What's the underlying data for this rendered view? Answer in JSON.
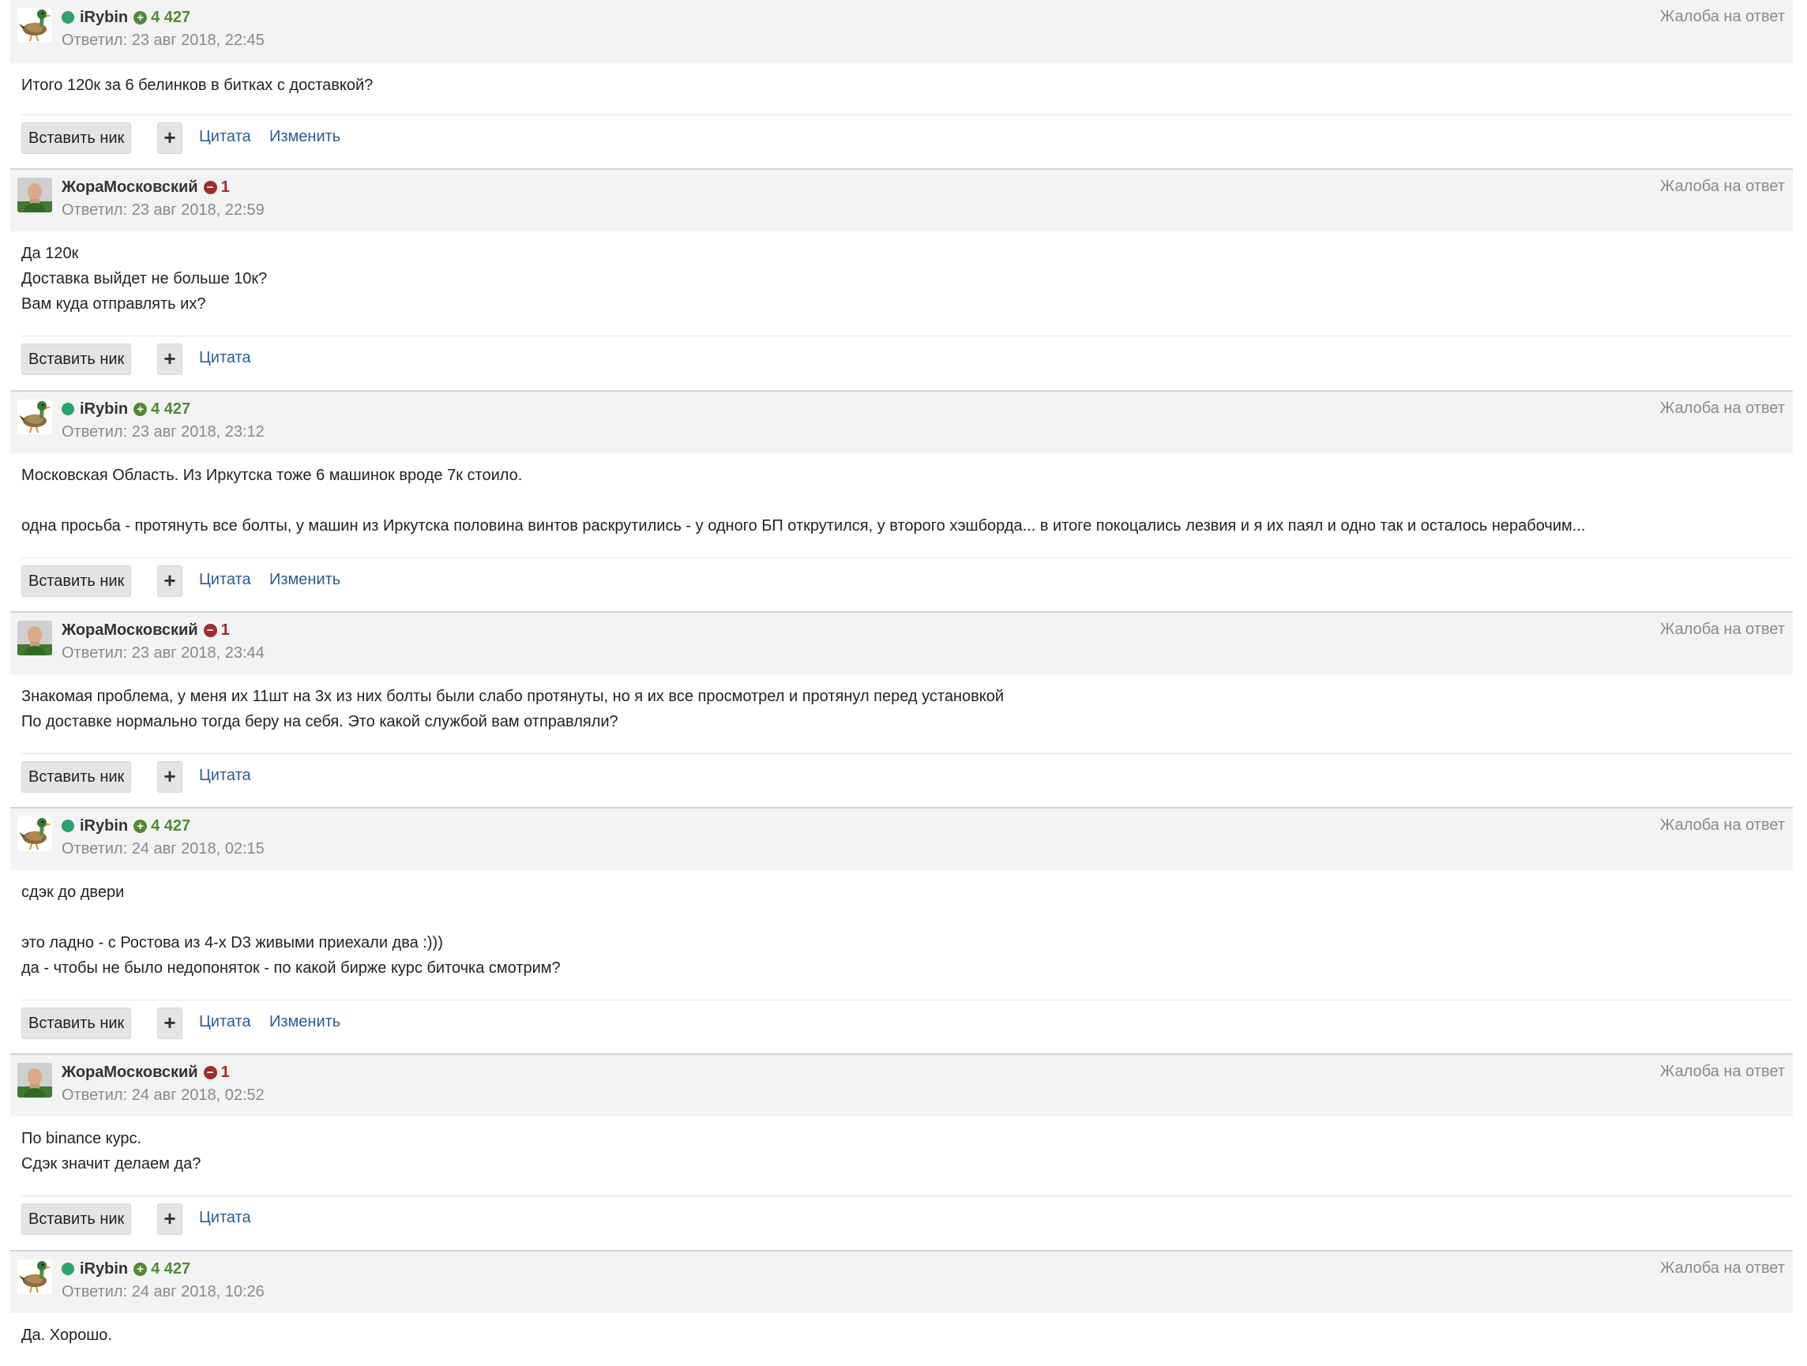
{
  "labels": {
    "report": "Жалоба на ответ",
    "insert_nick": "Вставить ник",
    "plus": "+",
    "quote": "Цитата",
    "edit": "Изменить"
  },
  "users": {
    "irybin": {
      "name": "iRybin",
      "rating": "4 427",
      "rating_sign": "positive",
      "online": true,
      "avatar": "duck-avatar"
    },
    "zhora": {
      "name": "ЖораМосковский",
      "rating": "1",
      "rating_sign": "negative",
      "online": false,
      "avatar": "man-avatar"
    }
  },
  "posts": [
    {
      "user": "irybin",
      "author": "iRybin",
      "rating": "4 427",
      "date": "Ответил: 23 авг 2018, 22:45",
      "lines": [
        "Итого 120к за 6 белинков в битках с доставкой?"
      ],
      "editable": true
    },
    {
      "user": "zhora",
      "author": "ЖораМосковский",
      "rating": "1",
      "date": "Ответил: 23 авг 2018, 22:59",
      "lines": [
        "Да 120к",
        "Доставка выйдет не больше 10к?",
        "Вам куда отправлять их?"
      ],
      "editable": false
    },
    {
      "user": "irybin",
      "author": "iRybin",
      "rating": "4 427",
      "date": "Ответил: 23 авг 2018, 23:12",
      "lines": [
        "Московская Область. Из Иркутска тоже 6 машинок вроде 7к стоило.",
        "",
        "одна просьба - протянуть все болты, у машин из Иркутска половина винтов раскрутились - у одного БП открутился, у второго хэшборда... в итоге покоцались лезвия и я их паял и одно так и осталось нерабочим..."
      ],
      "editable": true
    },
    {
      "user": "zhora",
      "author": "ЖораМосковский",
      "rating": "1",
      "date": "Ответил: 23 авг 2018, 23:44",
      "lines": [
        "Знакомая проблема, у меня их 11шт на 3х из них болты были слабо протянуты, но я их все просмотрел и протянул перед установкой",
        "По доставке нормально тогда беру на себя. Это какой службой вам отправляли?"
      ],
      "editable": false
    },
    {
      "user": "irybin",
      "author": "iRybin",
      "rating": "4 427",
      "date": "Ответил: 24 авг 2018, 02:15",
      "lines": [
        "сдэк до двери",
        "",
        "это ладно - с Ростова из 4-х D3 живыми приехали два :)))",
        "да - чтобы не было недопоняток - по какой бирже курс биточка смотрим?"
      ],
      "editable": true
    },
    {
      "user": "zhora",
      "author": "ЖораМосковский",
      "rating": "1",
      "date": "Ответил: 24 авг 2018, 02:52",
      "lines": [
        "По binance курс.",
        "Сдэк значит делаем да?"
      ],
      "editable": false
    },
    {
      "user": "irybin",
      "author": "iRybin",
      "rating": "4 427",
      "date": "Ответил: 24 авг 2018, 10:26",
      "lines": [
        "Да. Хорошо."
      ],
      "editable": true
    }
  ]
}
